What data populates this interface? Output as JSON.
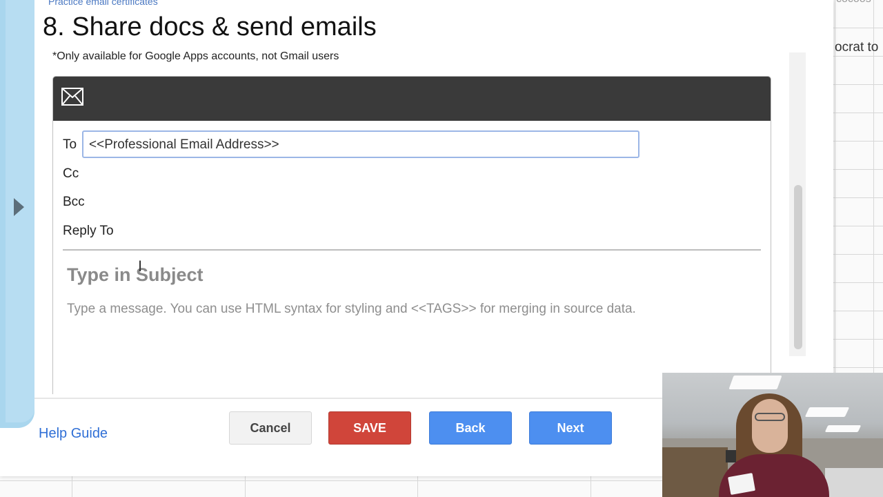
{
  "background": {
    "right_cell_text": "ocrat to",
    "right_top_text": "cocoos"
  },
  "dialog": {
    "breadcrumb": "Practice email certificates",
    "title": "8. Share docs & send emails",
    "note": "*Only available for Google Apps accounts, not Gmail users",
    "compose": {
      "icon": "mail-icon",
      "to_label": "To",
      "to_value": "<<Professional Email Address>>",
      "cc_label": "Cc",
      "bcc_label": "Bcc",
      "reply_to_label": "Reply To",
      "subject_placeholder": "Type in Subject",
      "message_placeholder": "Type a message. You can use HTML syntax for styling and <<TAGS>> for merging in source data."
    },
    "footer": {
      "help_label": "Help Guide",
      "cancel_label": "Cancel",
      "save_label": "SAVE",
      "back_label": "Back",
      "next_label": "Next"
    }
  },
  "colors": {
    "header_dark": "#3a3a3a",
    "save_red": "#d0453a",
    "nav_blue": "#4d8ff0",
    "link_blue": "#2f6fd6",
    "side_strip": "#b7ddf2"
  }
}
